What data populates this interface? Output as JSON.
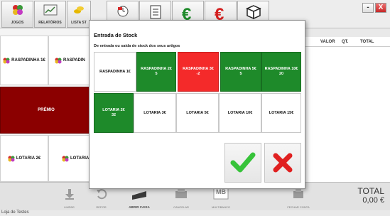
{
  "toolbar": {
    "buttons": [
      {
        "label": "JOGOS"
      },
      {
        "label": "RELATÓRIOS"
      },
      {
        "label": "LISTA ST"
      },
      {
        "label": ""
      },
      {
        "label": ""
      },
      {
        "label": ""
      },
      {
        "label": ""
      },
      {
        "label": ""
      }
    ]
  },
  "window": {
    "minimize": "-",
    "close": "X"
  },
  "products": {
    "raspadinha_1": "RASPADINHA 1€",
    "raspadinha_2": "RASPADIN",
    "premio": "PRÉMIO",
    "lotaria_2": "LOTARIA 2€",
    "lotaria_partial": "LOTARIA"
  },
  "receipt": {
    "col_valor": "VALOR",
    "col_qt": "QT.",
    "col_total": "TOTAL"
  },
  "bottom": {
    "buttons": [
      "LIMPAR",
      "REPOR",
      "ABRIR CAIXA",
      "CANCELAR",
      "MULTIBANCO",
      "FECHAR CONTA"
    ],
    "mb_logo": "MB"
  },
  "total": {
    "label": "TOTAL",
    "value": "0,00 €"
  },
  "footer": "Loja de Testes",
  "modal": {
    "title": "Entrada de Stock",
    "subtitle": "De entrada ou saída de stock dos seus artigos",
    "items": [
      {
        "name": "RASPADINHA 1€",
        "qty": ""
      },
      {
        "name": "RASPADINHA 2€",
        "qty": "5"
      },
      {
        "name": "RASPADINHA 3€",
        "qty": "-2"
      },
      {
        "name": "RASPADINHA 5€",
        "qty": "5"
      },
      {
        "name": "RASPADINHA 10€",
        "qty": "20"
      },
      {
        "name": "LOTARIA 2€",
        "qty": "32"
      },
      {
        "name": "LOTARIA 3€",
        "qty": ""
      },
      {
        "name": "LOTARIA 5€",
        "qty": ""
      },
      {
        "name": "LOTARIA 10€",
        "qty": ""
      },
      {
        "name": "LOTARIA 15€",
        "qty": ""
      }
    ]
  },
  "colors": {
    "green": "#1e8a2a",
    "red": "#f42a2a",
    "dark_red": "#8b0000",
    "checkmark": "#37c33a",
    "cross": "#e02020"
  }
}
